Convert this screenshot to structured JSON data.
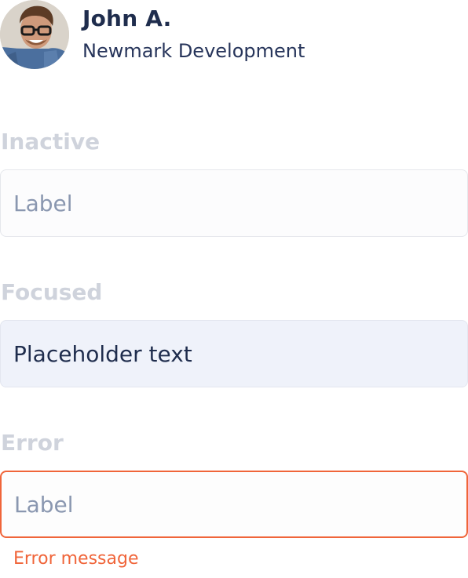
{
  "profile": {
    "name": "John A.",
    "company": "Newmark Development",
    "avatar_icon": "person-photo"
  },
  "sections": {
    "inactive": {
      "heading": "Inactive",
      "placeholder": "Label",
      "value": ""
    },
    "focused": {
      "heading": "Focused",
      "placeholder": "",
      "value": "Placeholder text"
    },
    "error": {
      "heading": "Error",
      "placeholder": "Label",
      "value": "",
      "message": "Error message"
    }
  },
  "colors": {
    "text_primary": "#1f2d4d",
    "label_muted": "#cfd3dc",
    "placeholder": "#8a97b0",
    "focused_bg": "#eff2fa",
    "error": "#f0653a",
    "border": "#e5e7ec"
  }
}
